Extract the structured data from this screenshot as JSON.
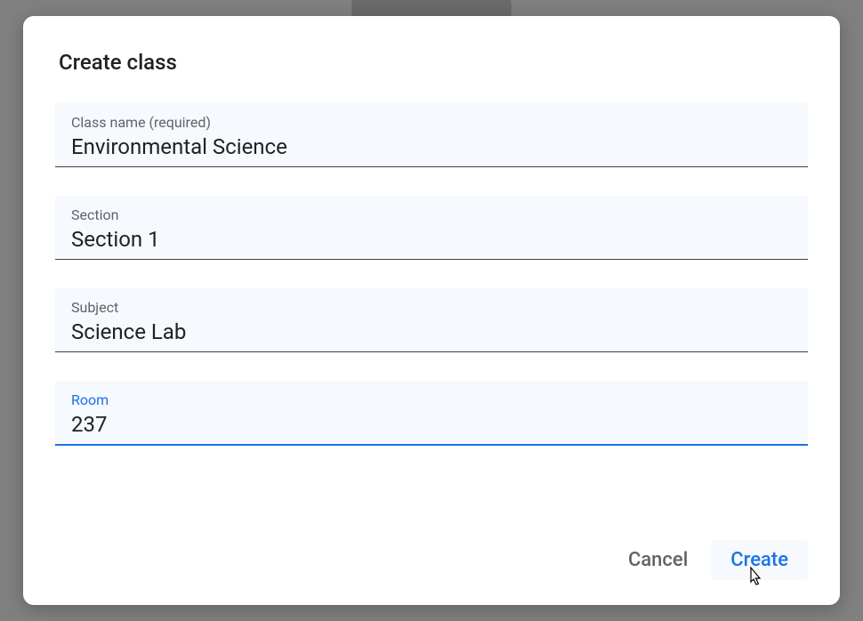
{
  "dialog": {
    "title": "Create class",
    "fields": {
      "class_name": {
        "label": "Class name (required)",
        "value": "Environmental Science"
      },
      "section": {
        "label": "Section",
        "value": "Section 1"
      },
      "subject": {
        "label": "Subject",
        "value": "Science Lab"
      },
      "room": {
        "label": "Room",
        "value": "237"
      }
    },
    "actions": {
      "cancel": "Cancel",
      "create": "Create"
    }
  }
}
